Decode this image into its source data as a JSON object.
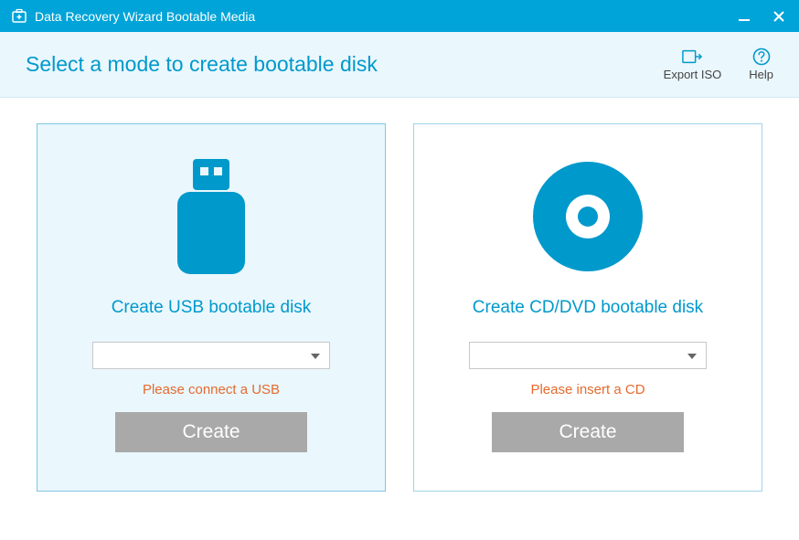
{
  "window": {
    "title": "Data Recovery Wizard Bootable Media"
  },
  "header": {
    "heading": "Select a mode to create bootable disk",
    "exportIso": "Export ISO",
    "help": "Help"
  },
  "cards": {
    "usb": {
      "title": "Create USB bootable disk",
      "hint": "Please connect a USB",
      "button": "Create"
    },
    "cd": {
      "title": "Create CD/DVD bootable disk",
      "hint": "Please insert a CD",
      "button": "Create"
    }
  },
  "colors": {
    "accent": "#00a4d8",
    "hint": "#e56a2e"
  }
}
